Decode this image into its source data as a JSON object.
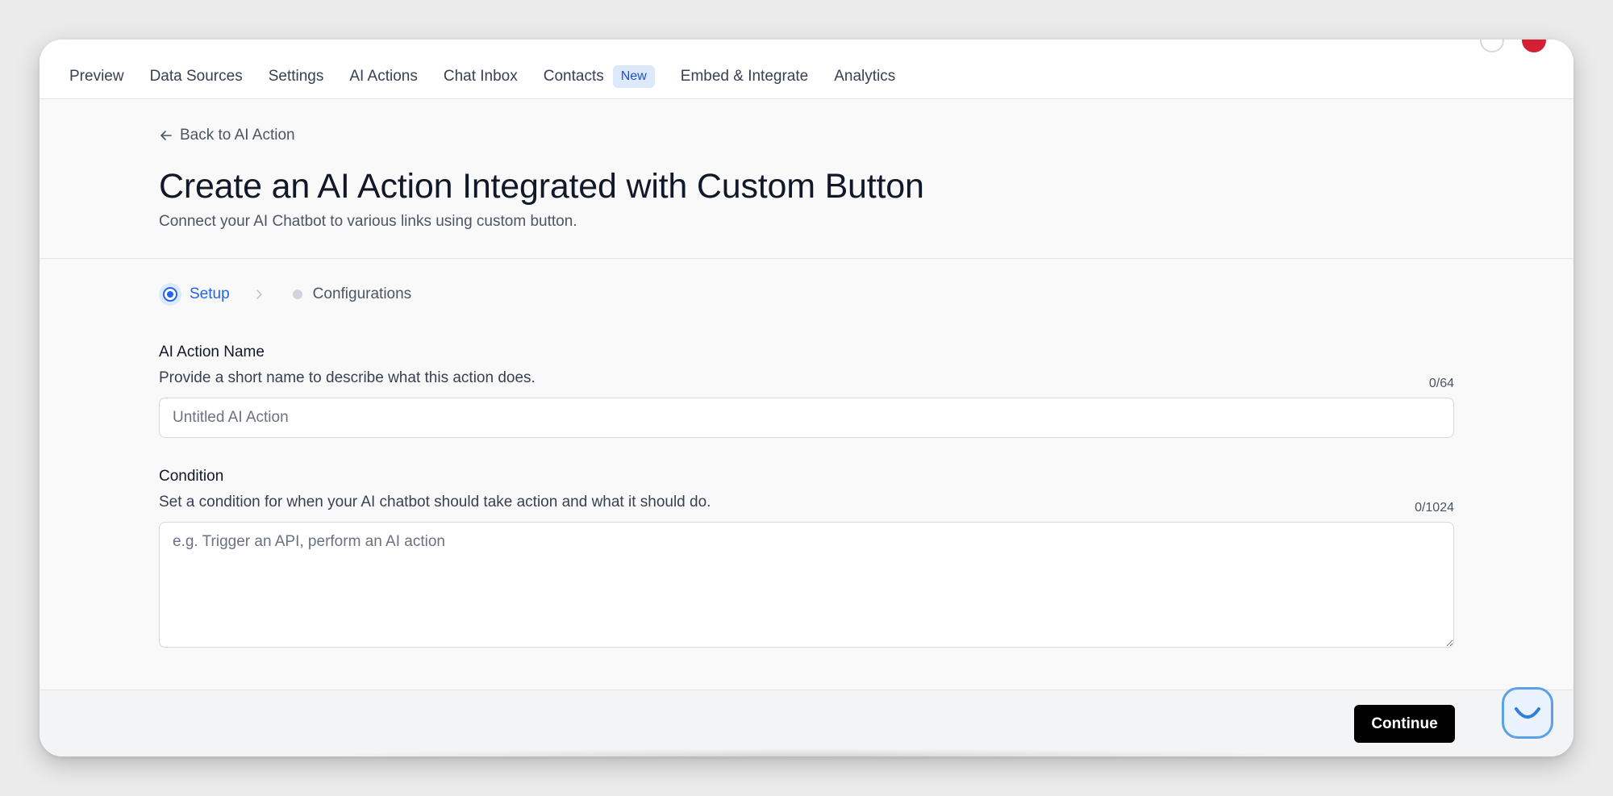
{
  "nav": {
    "items": [
      {
        "label": "Preview"
      },
      {
        "label": "Data Sources"
      },
      {
        "label": "Settings"
      },
      {
        "label": "AI Actions"
      },
      {
        "label": "Chat Inbox"
      },
      {
        "label": "Contacts",
        "badge": "New"
      },
      {
        "label": "Embed & Integrate"
      },
      {
        "label": "Analytics"
      }
    ]
  },
  "header": {
    "back_label": "Back to AI Action",
    "title": "Create an AI Action Integrated with Custom Button",
    "subtitle": "Connect your AI Chatbot to various links using custom button."
  },
  "steps": [
    {
      "label": "Setup",
      "state": "active"
    },
    {
      "label": "Configurations",
      "state": "pending"
    }
  ],
  "form": {
    "name": {
      "label": "AI Action Name",
      "description": "Provide a short name to describe what this action does.",
      "count": "0/64",
      "value": "",
      "placeholder": "Untitled AI Action"
    },
    "condition": {
      "label": "Condition",
      "description": "Set a condition for when your AI chatbot should take action and what it should do.",
      "count": "0/1024",
      "value": "",
      "placeholder": "e.g. Trigger an API, perform an AI action"
    }
  },
  "footer": {
    "continue_label": "Continue"
  },
  "colors": {
    "accent": "#2563eb",
    "badge_bg": "#dbe9fb",
    "primary_button": "#000000",
    "avatar": "#d51f35"
  },
  "icons": [
    "arrow-left-icon",
    "chevron-right-icon",
    "chat-widget-icon"
  ]
}
